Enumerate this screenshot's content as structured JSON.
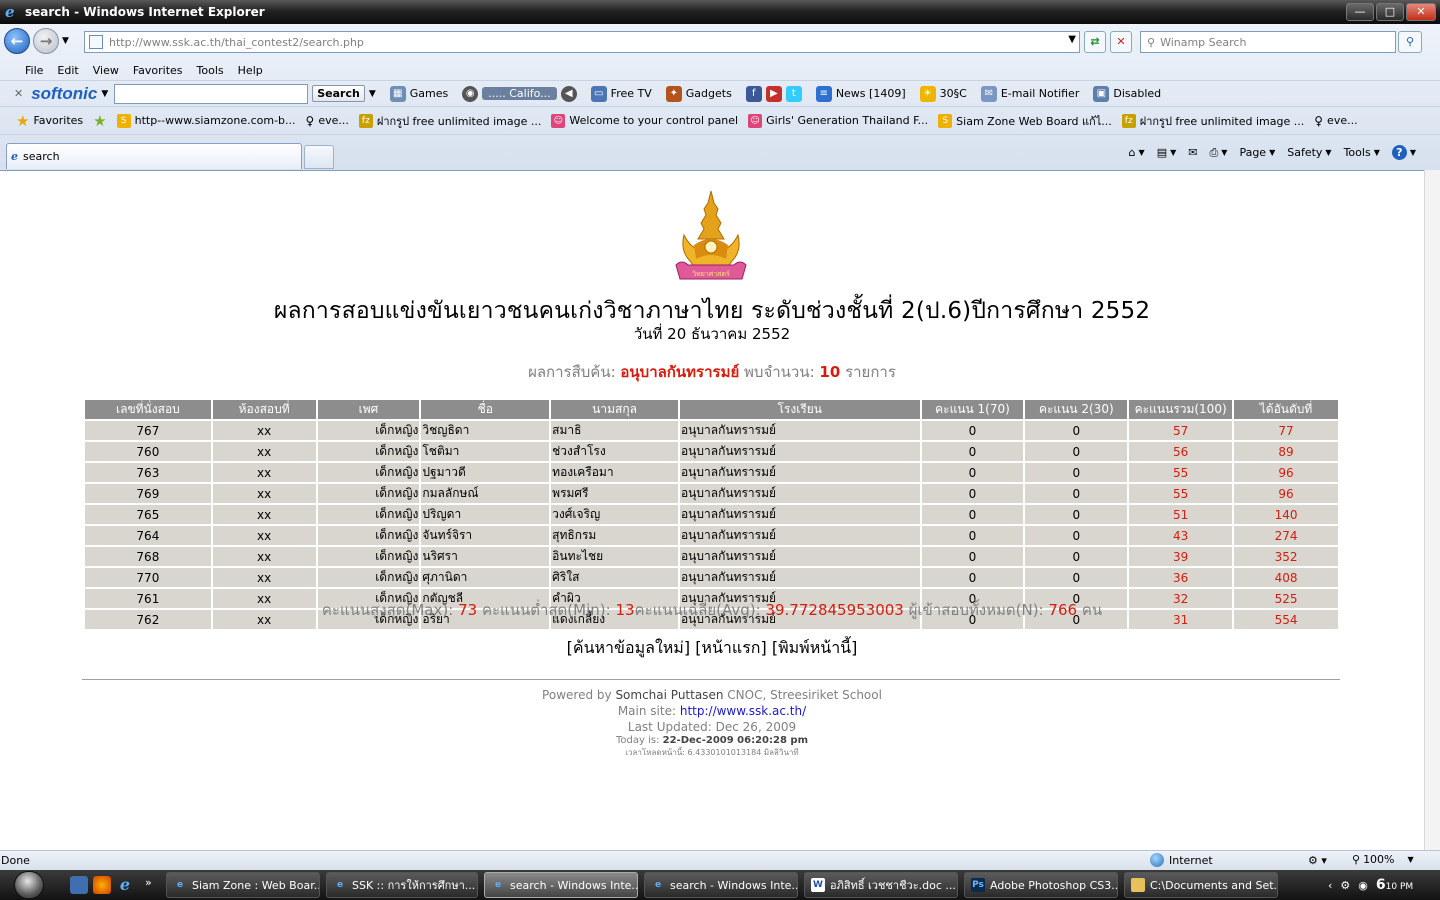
{
  "window": {
    "title": "search - Windows Internet Explorer",
    "buttons": {
      "minimize": "—",
      "maximize": "□",
      "close": "✕"
    }
  },
  "address": {
    "url_prefix": "http://www.ssk.ac.th",
    "url_path": "/thai_contest2/search.php"
  },
  "search_box": {
    "placeholder": "Winamp Search"
  },
  "menu": [
    "File",
    "Edit",
    "View",
    "Favorites",
    "Tools",
    "Help"
  ],
  "toolbar": {
    "brand": "softonic",
    "search_label": "Search",
    "items": [
      "Games",
      "..... Califo...",
      "Free TV",
      "Gadgets",
      "News [1409]",
      "30§C",
      "E-mail Notifier",
      "Disabled"
    ]
  },
  "favorites": {
    "label": "Favorites",
    "items": [
      "http--www.siamzone.com-b...",
      "eve...",
      "ฝากรูป free unlimited image ...",
      "Welcome to your control panel",
      "Girls' Generation Thailand F...",
      "Siam Zone  Web Board แก้ไ...",
      "ฝากรูป free unlimited image ...",
      "eve..."
    ]
  },
  "tab": {
    "label": "search"
  },
  "commands": [
    "Page",
    "Safety",
    "Tools"
  ],
  "page": {
    "heading": "ผลการสอบแข่งขันเยาวชนคนเก่งวิชาภาษาไทย ระดับช่วงชั้นที่ 2(ป.6)ปีการศึกษา 2552",
    "date": "วันที่ 20 ธันวาคม 2552",
    "result_prefix": "ผลการสืบค้น:",
    "school": "อนุบาลกันทรารมย์",
    "found_label": "พบจำนวน:",
    "found_count": "10",
    "found_suffix": "รายการ",
    "emblem_text": "วิทยาศาสตร์"
  },
  "table": {
    "headers": [
      "เลขที่นั่งสอบ",
      "ห้องสอบที่",
      "เพศ",
      "ชื่อ",
      "นามสกุล",
      "โรงเรียน",
      "คะแนน 1(70)",
      "คะแนน 2(30)",
      "คะแนนรวม(100)",
      "ได้อันดับที่"
    ],
    "rows": [
      [
        "767",
        "xx",
        "เด็กหญิง",
        "วิชญธิดา",
        "สมาธิ",
        "อนุบาลกันทรารมย์",
        "0",
        "0",
        "57",
        "77"
      ],
      [
        "760",
        "xx",
        "เด็กหญิง",
        "โชติมา",
        "ช่วงสำโรง",
        "อนุบาลกันทรารมย์",
        "0",
        "0",
        "56",
        "89"
      ],
      [
        "763",
        "xx",
        "เด็กหญิง",
        "ปฐมาวดี",
        "ทองเครือมา",
        "อนุบาลกันทรารมย์",
        "0",
        "0",
        "55",
        "96"
      ],
      [
        "769",
        "xx",
        "เด็กหญิง",
        "กมลลักษณ์",
        "พรมศรี",
        "อนุบาลกันทรารมย์",
        "0",
        "0",
        "55",
        "96"
      ],
      [
        "765",
        "xx",
        "เด็กหญิง",
        "ปริญดา",
        "วงศ์เจริญ",
        "อนุบาลกันทรารมย์",
        "0",
        "0",
        "51",
        "140"
      ],
      [
        "764",
        "xx",
        "เด็กหญิง",
        "จันทร์จิรา",
        "สุทธิกรม",
        "อนุบาลกันทรารมย์",
        "0",
        "0",
        "43",
        "274"
      ],
      [
        "768",
        "xx",
        "เด็กหญิง",
        "นริศรา",
        "อินทะไชย",
        "อนุบาลกันทรารมย์",
        "0",
        "0",
        "39",
        "352"
      ],
      [
        "770",
        "xx",
        "เด็กหญิง",
        "ศุภานิดา",
        "ศิริใส",
        "อนุบาลกันทรารมย์",
        "0",
        "0",
        "36",
        "408"
      ],
      [
        "761",
        "xx",
        "เด็กหญิง",
        "กตัญชลี",
        "คำผิว",
        "อนุบาลกันทรารมย์",
        "0",
        "0",
        "32",
        "525"
      ],
      [
        "762",
        "xx",
        "เด็กหญิง",
        "อริยา",
        "แดงเกลี้ยง",
        "อนุบาลกันทรารมย์",
        "0",
        "0",
        "31",
        "554"
      ]
    ]
  },
  "stats": {
    "max_label": "คะแนนสูงสุด(Max):",
    "max": "73",
    "min_label": "คะแนนต่ำสุด(Min):",
    "min": "13",
    "avg_label": "คะแนนเฉลี่ย(Avg):",
    "avg": "39.772845953003",
    "n_label": "ผู้เข้าสอบทั้งหมด(N):",
    "n": "766",
    "n_suffix": "คน"
  },
  "links": [
    "[ค้นหาข้อมูลใหม่]",
    "[หน้าแรก]",
    "[พิมพ์หน้านี้]"
  ],
  "footer": {
    "powered_label": "Powered by",
    "author": "Somchai Puttasen",
    "org": "CNOC, Streesiriket School",
    "main_site_label": "Main site:",
    "main_site": "http://www.ssk.ac.th/",
    "updated": "Last Updated: Dec 26, 2009",
    "today_label": "Today is:",
    "today": "22-Dec-2009 06:20:28 pm",
    "load_time": "เวลาโหลดหน้านี้: 6.4330101013184 มิลลิวินาที"
  },
  "status": {
    "text": "Done",
    "zone": "Internet",
    "zoom": "100%"
  },
  "taskbar": {
    "items": [
      "Siam Zone : Web Boar...",
      "SSK :: การให้การศึกษา...",
      "search - Windows Inte...",
      "search - Windows Inte...",
      "อภิสิทธิ์ เวชชาชีวะ.doc ...",
      "Adobe Photoshop CS3...",
      "C:\\Documents and Set..."
    ],
    "clock": "6",
    "clock_suffix": "10 PM"
  },
  "colors": {
    "accent_red": "#d61c0e",
    "header_grey": "#8d8d8d",
    "row_bg": "#d9d6cf",
    "link_blue": "#1a1acc"
  }
}
